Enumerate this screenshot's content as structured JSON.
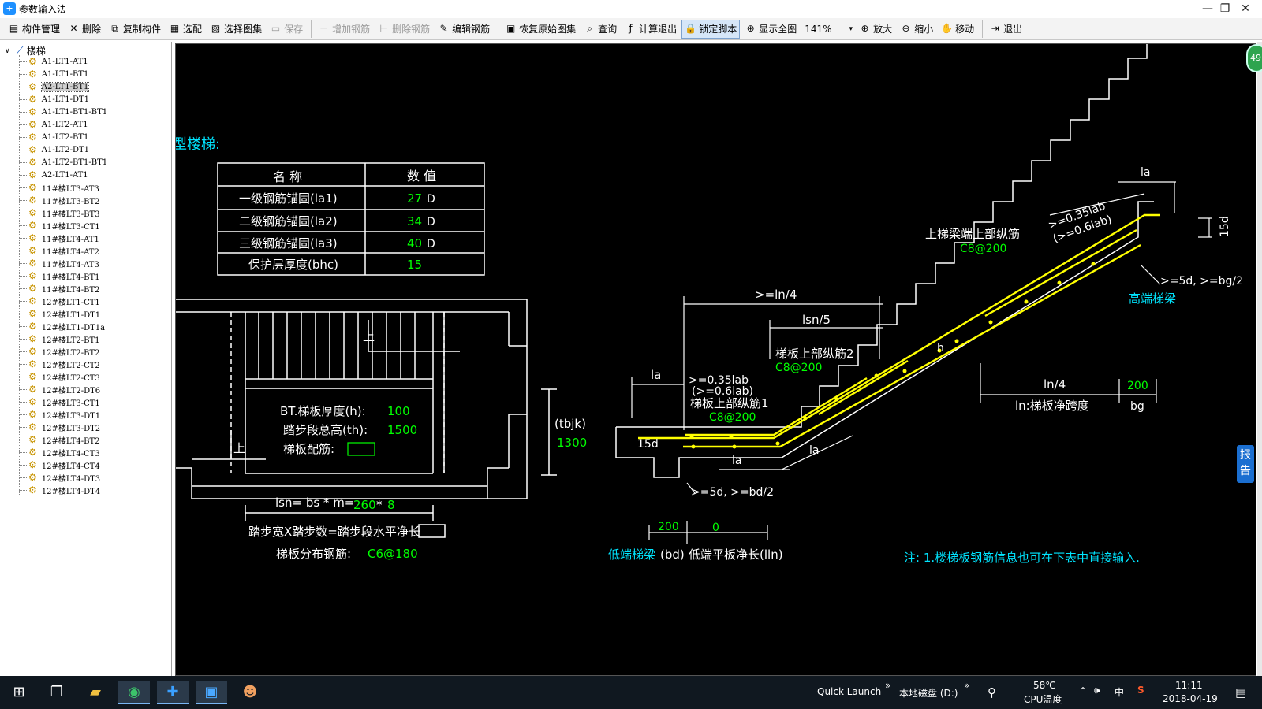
{
  "window": {
    "title": "参数输入法",
    "app_icon": "blue-plus-icon",
    "minimize": "—",
    "maximize": "❐",
    "close": "✕"
  },
  "toolbar": {
    "items": [
      {
        "label": "构件管理",
        "icon": "component-manage-icon",
        "glyph": "▤",
        "state": "normal"
      },
      {
        "label": "删除",
        "icon": "delete-icon",
        "glyph": "✕",
        "state": "normal"
      },
      {
        "label": "复制构件",
        "icon": "copy-icon",
        "glyph": "⧉",
        "state": "normal"
      },
      {
        "label": "选配",
        "icon": "select-match-icon",
        "glyph": "▦",
        "state": "normal"
      },
      {
        "label": "选择图集",
        "icon": "choose-atlas-icon",
        "glyph": "▧",
        "state": "normal"
      },
      {
        "label": "保存",
        "icon": "save-icon",
        "glyph": "▭",
        "state": "disabled"
      },
      {
        "sep": true
      },
      {
        "label": "增加钢筋",
        "icon": "add-rebar-icon",
        "glyph": "⊣",
        "state": "disabled"
      },
      {
        "label": "删除钢筋",
        "icon": "delete-rebar-icon",
        "glyph": "⊢",
        "state": "disabled"
      },
      {
        "label": "编辑钢筋",
        "icon": "edit-rebar-icon",
        "glyph": "✎",
        "state": "normal"
      },
      {
        "sep": true
      },
      {
        "label": "恢复原始图集",
        "icon": "restore-atlas-icon",
        "glyph": "▣",
        "state": "normal"
      },
      {
        "label": "查询",
        "icon": "query-icon",
        "glyph": "⌕",
        "state": "normal"
      },
      {
        "label": "计算退出",
        "icon": "calc-exit-icon",
        "glyph": "ƒ",
        "state": "normal"
      },
      {
        "label": "锁定脚本",
        "icon": "lock-icon",
        "glyph": "🔒",
        "state": "active"
      },
      {
        "label": "显示全图",
        "icon": "fit-view-icon",
        "glyph": "⊕",
        "state": "normal"
      },
      {
        "zoom": "141%"
      },
      {
        "label": "放大",
        "icon": "zoom-in-icon",
        "glyph": "⊕",
        "state": "normal"
      },
      {
        "label": "缩小",
        "icon": "zoom-out-icon",
        "glyph": "⊖",
        "state": "normal"
      },
      {
        "label": "移动",
        "icon": "pan-hand-icon",
        "glyph": "✋",
        "state": "normal"
      },
      {
        "sep": true
      },
      {
        "label": "退出",
        "icon": "exit-icon",
        "glyph": "⇥",
        "state": "normal"
      }
    ]
  },
  "tree": {
    "root": "楼梯",
    "items": [
      "A1-LT1-AT1",
      "A1-LT1-BT1",
      "A2-LT1-BT1",
      "A1-LT1-DT1",
      "A1-LT1-BT1-BT1",
      "A1-LT2-AT1",
      "A1-LT2-BT1",
      "A1-LT2-DT1",
      "A1-LT2-BT1-BT1",
      "A2-LT1-AT1",
      "11#楼LT3-AT3",
      "11#楼LT3-BT2",
      "11#楼LT3-BT3",
      "11#楼LT3-CT1",
      "11#楼LT4-AT1",
      "11#楼LT4-AT2",
      "11#楼LT4-AT3",
      "11#楼LT4-BT1",
      "11#楼LT4-BT2",
      "12#楼LT1-CT1",
      "12#楼LT1-DT1",
      "12#楼LT1-DT1a",
      "12#楼LT2-BT1",
      "12#楼LT2-BT2",
      "12#楼LT2-CT2",
      "12#楼LT2-CT3",
      "12#楼LT2-DT6",
      "12#楼LT3-CT1",
      "12#楼LT3-DT1",
      "12#楼LT3-DT2",
      "12#楼LT4-BT2",
      "12#楼LT4-CT3",
      "12#楼LT4-CT4",
      "12#楼LT4-DT3",
      "12#楼LT4-DT4"
    ],
    "selected_index": 2
  },
  "drawing": {
    "heading": "型楼梯:",
    "table": {
      "headers": [
        "名  称",
        "数  值"
      ],
      "rows": [
        {
          "name": "一级钢筋锚固(la1)",
          "value": "27",
          "unit": "D"
        },
        {
          "name": "二级钢筋锚固(la2)",
          "value": "34",
          "unit": "D"
        },
        {
          "name": "三级钢筋锚固(la3)",
          "value": "40",
          "unit": "D"
        },
        {
          "name": "保护层厚度(bhc)",
          "value": "15",
          "unit": ""
        }
      ]
    },
    "plan": {
      "up1": "上",
      "up2": "上",
      "thickness_label": "BT.梯板厚度(h):",
      "thickness_value": "100",
      "height_label": "踏步段总高(th):",
      "height_value": "1500",
      "rebar_label": "梯板配筋:",
      "tbjk_label": "(tbjk)",
      "tbjk_value": "1300",
      "lsn_prefix": "lsn= bs * m=",
      "lsn_bs": "260",
      "lsn_mid": "*",
      "lsn_m": "8",
      "step_caption": "踏步宽X踏步数=踏步段水平净长",
      "dist_label": "梯板分布钢筋:",
      "dist_value": "C6@180"
    },
    "section": {
      "la_top": "la",
      "ge_035_top": ">=0.35lab",
      "ge_06_top": "(>=0.6lab)",
      "d15_right": "15d",
      "upper_beam_bar": "上梯梁端上部纵筋",
      "upper_beam_bar_value": "C8@200",
      "ge5d_bg2": ">=5d, >=bg/2",
      "high_beam": "高端梯梁",
      "ln4_top": ">=ln/4",
      "lsn5": "lsn/5",
      "h_label": "h",
      "top_bar2": "梯板上部纵筋2",
      "top_bar2_value": "C8@200",
      "la_left": "la",
      "ge_035_left": ">=0.35lab",
      "ge_06_left": "(>=0.6lab)",
      "top_bar1": "梯板上部纵筋1",
      "top_bar1_value": "C8@200",
      "d15_left": "15d",
      "la_bottom1": "la",
      "la_bottom2": "la",
      "ge5d_bd2": ">=5d, >=bd/2",
      "ln4_right": "ln/4",
      "bg_value": "200",
      "ln_span": "ln:梯板净跨度",
      "bg_label": "bg",
      "bd_value": "200",
      "lln_value": "0",
      "low_beam": "低端梯梁",
      "bd_label": "(bd)",
      "lln_label": "低端平板净长(lln)"
    },
    "note": "注: 1.楼梯板钢筋信息也可在下表中直接输入."
  },
  "side": {
    "badge": "49",
    "report_tab": "报告"
  },
  "taskbar": {
    "quick_launch": "Quick Launch",
    "quick_chev": "»",
    "disk": "本地磁盘 (D:)",
    "disk_chev": "»",
    "temp": "58℃",
    "temp_label": "CPU温度",
    "ime": "中",
    "volume": "🕪",
    "time": "11:11",
    "date": "2018-04-19",
    "icons": [
      "windows-start-icon",
      "task-view-icon",
      "file-explorer-icon",
      "green-app-icon",
      "blue-plus-app-icon",
      "drawing-app-icon",
      "people-app-icon"
    ]
  },
  "colors": {
    "canvas": "#000000",
    "yellow": "#ffff00",
    "green": "#00ff00",
    "cyan": "#00e5ff",
    "white": "#ffffff"
  }
}
